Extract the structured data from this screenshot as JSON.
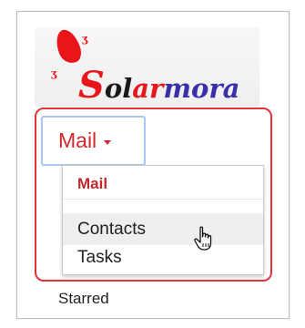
{
  "logo": {
    "text": "Solarmora"
  },
  "app_switcher": {
    "label": "Mail"
  },
  "menu": {
    "items": [
      {
        "label": "Mail",
        "selected": true
      },
      {
        "label": "Contacts",
        "hovered": true
      },
      {
        "label": "Tasks"
      }
    ]
  },
  "nav": {
    "starred_label": "Starred"
  },
  "colors": {
    "accent_red": "#d4282e",
    "highlight_border": "#e3323a",
    "focus_blue": "#a9c7f2"
  },
  "icons": {
    "cursor": "hand-pointer-icon",
    "caret": "chevron-down-icon"
  }
}
